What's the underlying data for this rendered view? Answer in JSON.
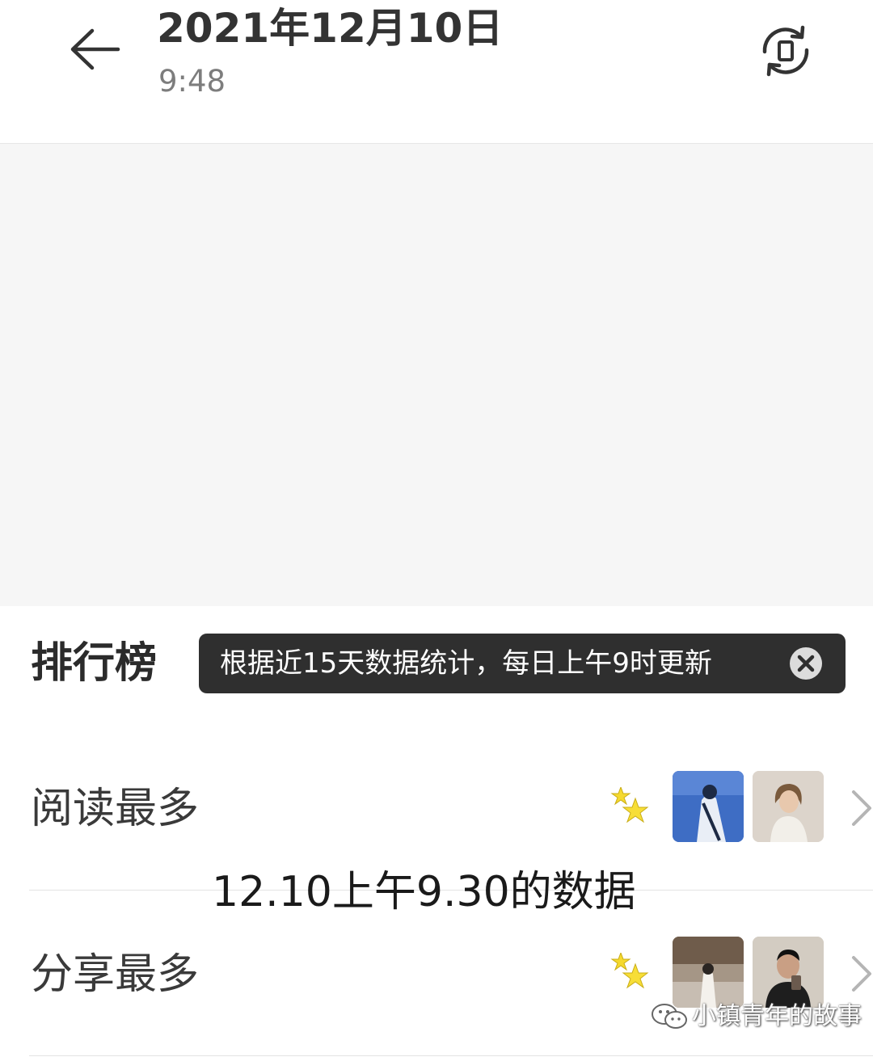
{
  "header": {
    "title": "2021年12月10日",
    "subtitle": "9:48",
    "back_icon": "arrow-left-icon",
    "rotate_icon": "rotate-screen-icon"
  },
  "ranking": {
    "title": "排行榜",
    "tooltip": "根据近15天数据统计，每日上午9时更新",
    "tooltip_close_icon": "close-circle-icon",
    "rows": [
      {
        "label": "阅读最多",
        "icons": [
          "sparkle-icon",
          "avatar",
          "avatar",
          "chevron-right-icon"
        ]
      },
      {
        "label": "分享最多",
        "icons": [
          "sparkle-icon",
          "avatar",
          "avatar",
          "chevron-right-icon"
        ]
      }
    ]
  },
  "overlay_caption": "12.10上午9.30的数据",
  "watermark": {
    "text": "小镇青年的故事",
    "icon": "wechat-icon"
  },
  "colors": {
    "tooltip_bg": "#2f2f2f",
    "blank_area": "#f6f6f6",
    "sparkle": "#f5d92e"
  }
}
